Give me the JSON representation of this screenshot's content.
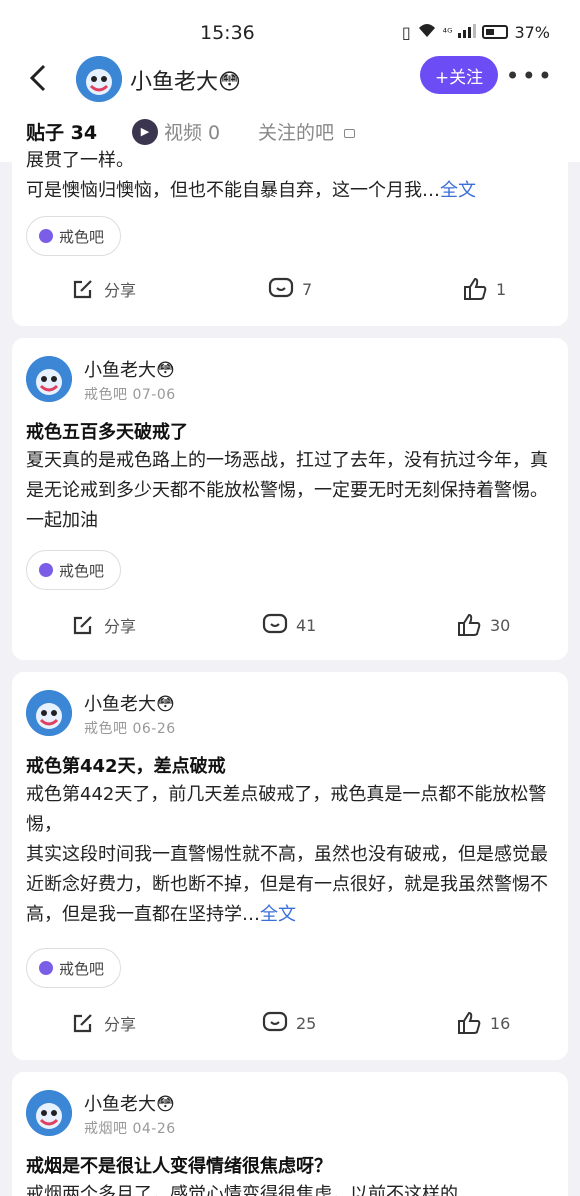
{
  "status": {
    "time": "15:36",
    "battery": "37%",
    "network": "⁴ᴳ"
  },
  "header": {
    "name": "小鱼老大😳",
    "follow_label": "+关注",
    "more": "•••",
    "tabs": [
      {
        "label": "贴子 34"
      },
      {
        "label": "视频 0"
      },
      {
        "label": "关注的吧"
      }
    ]
  },
  "posts": [
    {
      "partial_top": "展贯了一样。",
      "body": "可是懊恼归懊恼，但也不能自暴自弃，这一个月我…",
      "full_text_link": "全文",
      "tag": "戒色吧",
      "share": "分享",
      "comments": "7",
      "likes": "1"
    },
    {
      "author": "小鱼老大😳",
      "forum": "戒色吧",
      "date": "07-06",
      "title": "戒色五百多天破戒了",
      "body": "夏天真的是戒色路上的一场恶战，扛过了去年，没有抗过今年，真是无论戒到多少天都不能放松警惕，一定要无时无刻保持着警惕。一起加油",
      "tag": "戒色吧",
      "share": "分享",
      "comments": "41",
      "likes": "30"
    },
    {
      "author": "小鱼老大😳",
      "forum": "戒色吧",
      "date": "06-26",
      "title": "戒色第442天，差点破戒",
      "body_lines": [
        "戒色第442天了，前几天差点破戒了，戒色真是一点都不能放松警惕，",
        "其实这段时间我一直警惕性就不高，虽然也没有破戒，但是感觉最近断念好费力，断也断不掉，但是有一点很好，就是我虽然警惕不高，但是我一直都在坚持学…"
      ],
      "full_text_link": "全文",
      "tag": "戒色吧",
      "share": "分享",
      "comments": "25",
      "likes": "16"
    },
    {
      "author": "小鱼老大😳",
      "forum": "戒烟吧",
      "date": "04-26",
      "title": "戒烟是不是很让人变得情绪很焦虑呀？",
      "body": "戒烟两个多月了，感觉心情变得很焦虑，以前不这样的"
    }
  ]
}
